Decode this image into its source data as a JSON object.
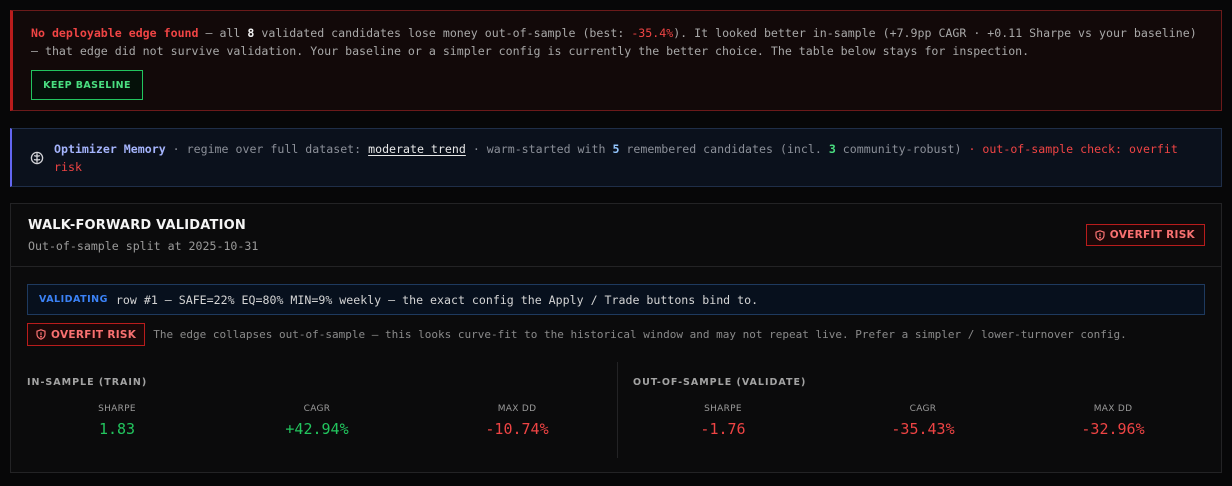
{
  "alert": {
    "headline": "No deployable edge found",
    "t1": " — all ",
    "count": "8",
    "t2": " validated candidates lose money out-of-sample (best: ",
    "best": "-35.4%",
    "t3": "). It looked better in-sample (+7.9pp CAGR · +0.11 Sharpe vs your baseline)",
    "line2": "— that edge did not survive validation. Your baseline or a simpler config is currently the better choice. The table below stays for inspection.",
    "button_label": "KEEP BASELINE"
  },
  "memory": {
    "icon": "brain-icon",
    "title": "Optimizer Memory",
    "t1": " · regime over full dataset: ",
    "regime": "moderate trend",
    "t2": " · warm-started with ",
    "remembered": "5",
    "t3": " remembered candidates (incl. ",
    "robust": "3",
    "t4": " community-robust) ",
    "warning": "· out-of-sample check: overfit risk"
  },
  "walkforward": {
    "title": "WALK-FORWARD VALIDATION",
    "subtitle": "Out-of-sample split at 2025-10-31",
    "badge": "OVERFIT RISK",
    "validating_tag": "VALIDATING",
    "validating_text": "row #1 — SAFE=22% EQ=80% MIN=9% weekly — the exact config the Apply / Trade buttons bind to.",
    "overfit_badge": "OVERFIT RISK",
    "overfit_msg": "The edge collapses out-of-sample — this looks curve-fit to the historical window and may not repeat live. Prefer a simpler / lower-turnover config.",
    "train": {
      "title": "IN-SAMPLE (TRAIN)",
      "metrics": [
        {
          "label": "SHARPE",
          "value": "1.83"
        },
        {
          "label": "CAGR",
          "value": "+42.94%"
        },
        {
          "label": "MAX DD",
          "value": "-10.74%"
        }
      ]
    },
    "validate": {
      "title": "OUT-OF-SAMPLE (VALIDATE)",
      "metrics": [
        {
          "label": "SHARPE",
          "value": "-1.76"
        },
        {
          "label": "CAGR",
          "value": "-35.43%"
        },
        {
          "label": "MAX DD",
          "value": "-32.96%"
        }
      ]
    }
  },
  "colors": {
    "positive": "#22c55e",
    "negative": "#ef4444",
    "accent": "#6366f1"
  }
}
